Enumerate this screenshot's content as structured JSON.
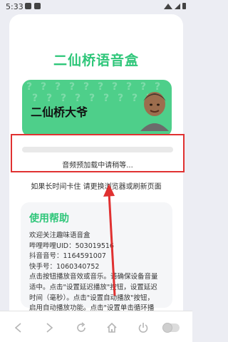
{
  "status_bar": {
    "time": "5:33"
  },
  "app": {
    "title": "二仙桥语音盒",
    "banner_text": "二仙桥大爷"
  },
  "loading_overlay": {
    "message": "音频预加载中请稍等..."
  },
  "hint": "如果长时间卡住 请更换浏览器或刷新页面",
  "help": {
    "title": "使用帮助",
    "lines": [
      "欢迎关注趣味语音盒",
      "哔哩哔哩UID：503019516",
      "抖音音号：1164591007",
      "快手号：1060340752",
      "点击按钮播放音效或音乐。请确保设备音量",
      "适中。点击\"设置延迟播放\"按钮，设置延迟",
      "时间（毫秒）。点击\"设置自动播放\"按钮，",
      "启用自动播放功能。点击\"设置单击循环播"
    ]
  },
  "colors": {
    "accent": "#2ec679",
    "banner": "#4ecf8a",
    "highlight": "#e03131"
  },
  "icons": [
    "back-icon",
    "forward-icon",
    "refresh-icon",
    "home-icon",
    "power-icon",
    "toggle-switch"
  ]
}
